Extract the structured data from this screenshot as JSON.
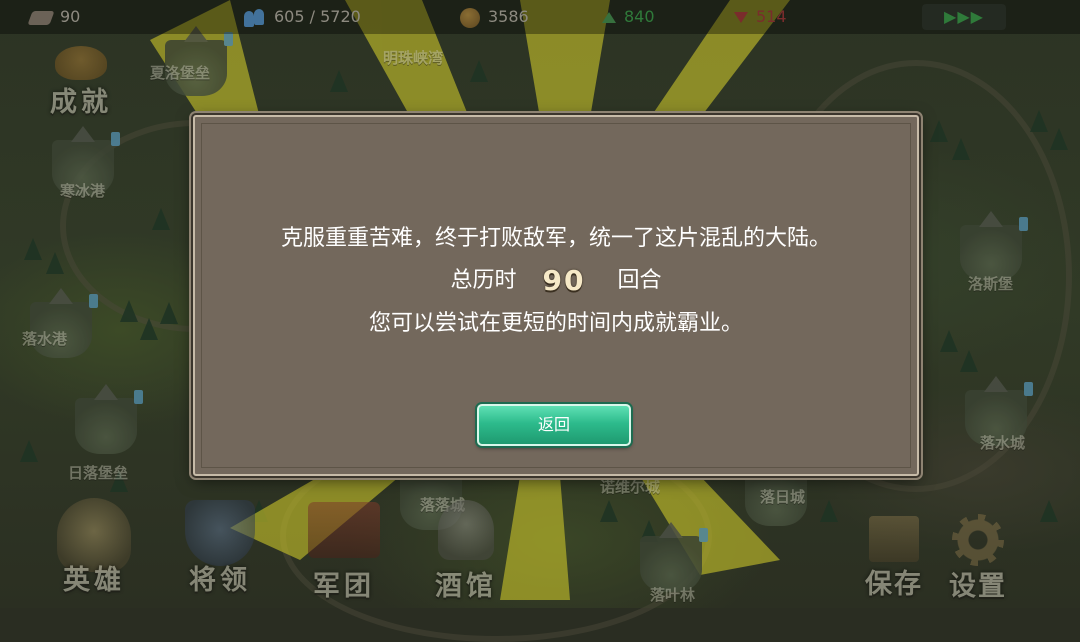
{
  "topbar": {
    "turn": "90",
    "population": "605 / 5720",
    "gold": "3586",
    "morale_up": "840",
    "morale_down": "514",
    "speed": "▶▶▶"
  },
  "map_labels": [
    "夏洛堡垒",
    "明珠峡湾",
    "寒冰港",
    "落水港",
    "洛斯堡",
    "日落堡垒",
    "落落城",
    "诺维尔城",
    "落水城",
    "落日城",
    "落叶林"
  ],
  "menu": {
    "achievements": "成就",
    "heroes": "英雄",
    "generals": "将领",
    "legions": "军团",
    "tavern": "酒馆",
    "save": "保存",
    "settings": "设置"
  },
  "dialog": {
    "line1": "克服重重苦难，终于打败敌军，统一了这片混乱的大陆。",
    "total_label": "总历时",
    "turns": "90",
    "turns_unit": "回合",
    "line3": "您可以尝试在更短的时间内成就霸业。",
    "return_label": "返回"
  },
  "colors": {
    "dialog_bg": "#73685c",
    "button_green": "#2dbb8c",
    "ray_yellow": "#c7c22a"
  },
  "icons": [
    "turn-icon",
    "population-icon",
    "gold-icon",
    "morale-up-icon",
    "morale-down-icon",
    "achievement-icon",
    "hero-icon",
    "general-icon",
    "legion-icon",
    "tavern-icon",
    "save-icon",
    "gear-icon"
  ]
}
